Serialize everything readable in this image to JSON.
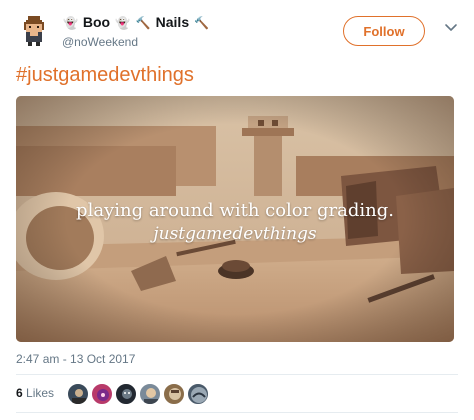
{
  "tweet": {
    "display_name": "Boo",
    "display_name_2": "Nails",
    "name_emojis": [
      "👻",
      "👻",
      "🔨",
      "🔨"
    ],
    "handle": "@noWeekend",
    "follow_label": "Follow",
    "text": "#justgamedevthings",
    "timestamp": "2:47 am - 13 Oct 2017",
    "likes_count": "6",
    "likes_label": "Likes"
  },
  "media": {
    "overlay_line_1": "playing around with color grading.",
    "overlay_line_2": "justgamedevthings"
  },
  "icons": {
    "caret": "chevron-down-icon",
    "avatar": "pixel-avatar"
  },
  "colors": {
    "accent": "#e0712b",
    "secondary_text": "#657786",
    "divider": "#e6ecf0"
  }
}
